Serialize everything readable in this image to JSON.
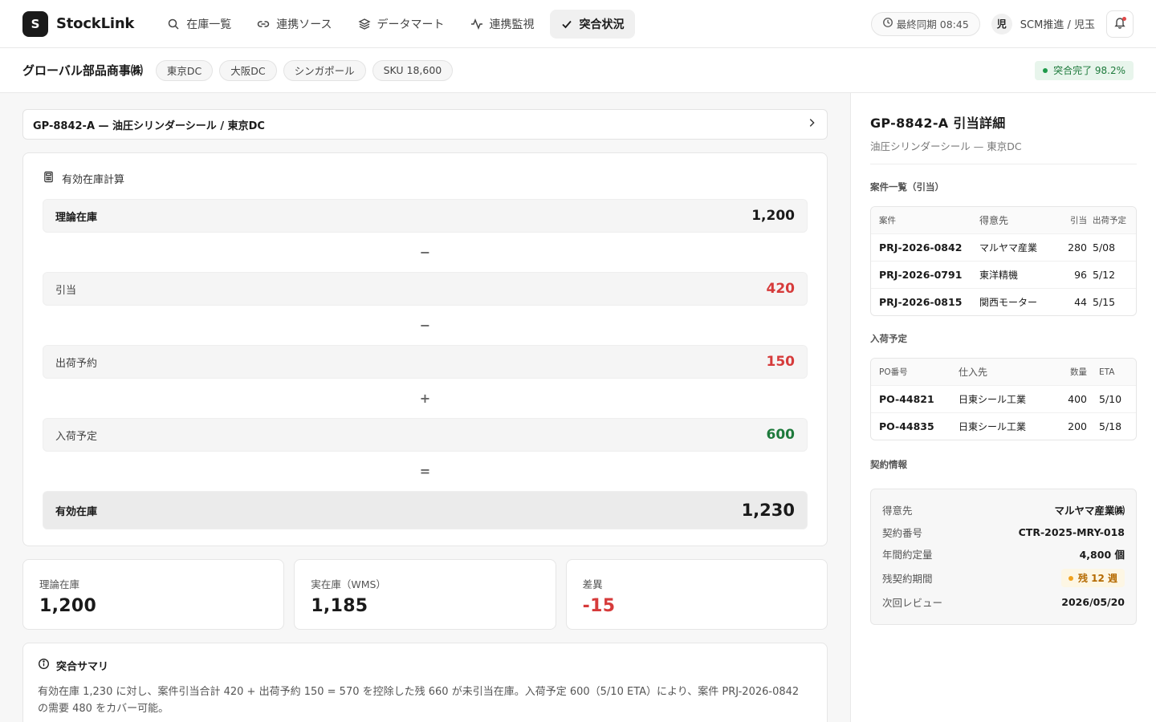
{
  "app": {
    "logo_letter": "S",
    "name": "StockLink"
  },
  "nav": [
    {
      "label": "在庫一覧",
      "icon": "search-icon"
    },
    {
      "label": "連携ソース",
      "icon": "link-icon"
    },
    {
      "label": "データマート",
      "icon": "layers-icon"
    },
    {
      "label": "連携監視",
      "icon": "activity-icon"
    },
    {
      "label": "突合状況",
      "icon": "check-icon",
      "active": true
    }
  ],
  "header": {
    "sync_label": "最終同期 08:45",
    "avatar": "児",
    "user": "SCM推進 / 児玉"
  },
  "subheader": {
    "company": "グローバル部品商事㈱",
    "chips": [
      "東京DC",
      "大阪DC",
      "シンガポール",
      "SKU 18,600"
    ],
    "status": "突合完了 98.2%"
  },
  "item_selector": "GP-8842-A — 油圧シリンダーシール / 東京DC",
  "calc": {
    "title": "有効在庫計算",
    "rows": [
      {
        "label": "理論在庫",
        "value": "1,200"
      },
      {
        "op": "−"
      },
      {
        "label": "引当",
        "value": "420"
      },
      {
        "op": "−"
      },
      {
        "label": "出荷予約",
        "value": "150"
      },
      {
        "op": "+"
      },
      {
        "label": "入荷予定",
        "value": "600"
      },
      {
        "op": "="
      },
      {
        "label": "有効在庫",
        "value": "1,230"
      }
    ]
  },
  "stats": [
    {
      "label": "理論在庫",
      "value": "1,200"
    },
    {
      "label": "実在庫（WMS）",
      "value": "1,185"
    },
    {
      "label": "差異",
      "value": "-15"
    }
  ],
  "summary": {
    "title": "突合サマリ",
    "text": "有効在庫 1,230 に対し、案件引当合計 420 + 出荷予約 150 = 570 を控除した残 660 が未引当在庫。入荷予定 600（5/10 ETA）により、案件 PRJ-2026-0842 の需要 480 をカバー可能。"
  },
  "detail": {
    "title": "GP-8842-A 引当詳細",
    "subtitle": "油圧シリンダーシール — 東京DC",
    "alloc_section": "案件一覧（引当）",
    "alloc_headers": [
      "案件",
      "得意先",
      "引当",
      "出荷予定"
    ],
    "alloc_rows": [
      [
        "PRJ-2026-0842",
        "マルヤマ産業",
        "280",
        "5/08"
      ],
      [
        "PRJ-2026-0791",
        "東洋精機",
        "96",
        "5/12"
      ],
      [
        "PRJ-2026-0815",
        "関西モーター",
        "44",
        "5/15"
      ]
    ],
    "inbound_section": "入荷予定",
    "inbound_headers": [
      "PO番号",
      "仕入先",
      "数量",
      "ETA"
    ],
    "inbound_rows": [
      [
        "PO-44821",
        "日東シール工業",
        "400",
        "5/10"
      ],
      [
        "PO-44835",
        "日東シール工業",
        "200",
        "5/18"
      ]
    ],
    "contract_section": "契約情報",
    "contract": [
      {
        "k": "得意先",
        "v": "マルヤマ産業㈱"
      },
      {
        "k": "契約番号",
        "v": "CTR-2025-MRY-018"
      },
      {
        "k": "年間約定量",
        "v": "4,800 個"
      },
      {
        "k": "残契約期間",
        "v": "残 12 週"
      },
      {
        "k": "次回レビュー",
        "v": "2026/05/20"
      }
    ]
  },
  "colors": {
    "negative": "#d63b3b",
    "positive": "#1e7a3c",
    "warning": "#f0a21f"
  }
}
